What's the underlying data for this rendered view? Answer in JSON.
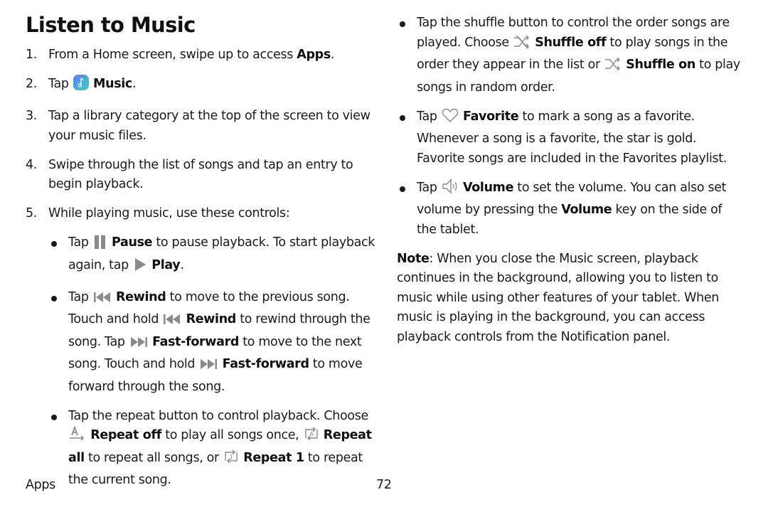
{
  "page": {
    "title": "Listen to Music",
    "footer": {
      "section": "Apps",
      "page_number": "72"
    }
  },
  "steps": [
    {
      "num": "1.",
      "parts": [
        "From a Home screen, swipe up to access ",
        "Apps",
        "."
      ]
    },
    {
      "num": "2.",
      "parts": [
        "Tap ",
        "Music",
        "."
      ],
      "icon": "music-app-icon"
    },
    {
      "num": "3.",
      "text": "Tap a library category at the top of the screen to view your music files."
    },
    {
      "num": "4.",
      "text": "Swipe through the list of songs and tap an entry to begin playback."
    },
    {
      "num": "5.",
      "text": "While playing music, use these controls:"
    }
  ],
  "controls": {
    "pause_play": {
      "t1": "Tap ",
      "pause": "Pause",
      "t2": " to pause playback. To start playback again, tap ",
      "play": "Play",
      "t3": "."
    },
    "rewind_ff": {
      "t1": "Tap ",
      "rewind1": "Rewind",
      "t2": " to move to the previous song. Touch and hold ",
      "rewind2": "Rewind",
      "t3": " to rewind through the song. Tap ",
      "ff1": "Fast-forward",
      "t4": " to move to the next song. Touch and hold ",
      "ff2": "Fast-forward",
      "t5": " to move forward through the song."
    },
    "repeat": {
      "t1": "Tap the repeat button to control playback. Choose ",
      "off": "Repeat off",
      "t2": " to play all songs once, ",
      "all": "Repeat all",
      "t3": " to repeat all songs, or ",
      "one": "Repeat 1",
      "t4": " to repeat the current song."
    },
    "shuffle": {
      "t1": "Tap the shuffle button to control the order songs are played. Choose ",
      "off": "Shuffle off",
      "t2": " to play songs in the order they appear in the list or ",
      "on": "Shuffle on",
      "t3": " to play songs in random order."
    },
    "favorite": {
      "t1": "Tap ",
      "label": "Favorite",
      "t2": " to mark a song as a favorite. Whenever a song is a favorite, the star is gold. Favorite songs are included in the Favorites playlist."
    },
    "volume": {
      "t1": "Tap ",
      "label": "Volume",
      "t2": " to set the volume. You can also set volume by pressing the ",
      "key": "Volume",
      "t3": " key on the side of the tablet."
    }
  },
  "note": {
    "label": "Note",
    "text": ": When you close the Music screen, playback continues in the background, allowing you to listen to music while using other features of your tablet. When music is playing in the background, you can access playback controls from the Notification panel."
  },
  "colors": {
    "icon_gray": "#8a8a8a",
    "music_icon_start": "#5b7cf0",
    "music_icon_end": "#3fd1c8"
  }
}
